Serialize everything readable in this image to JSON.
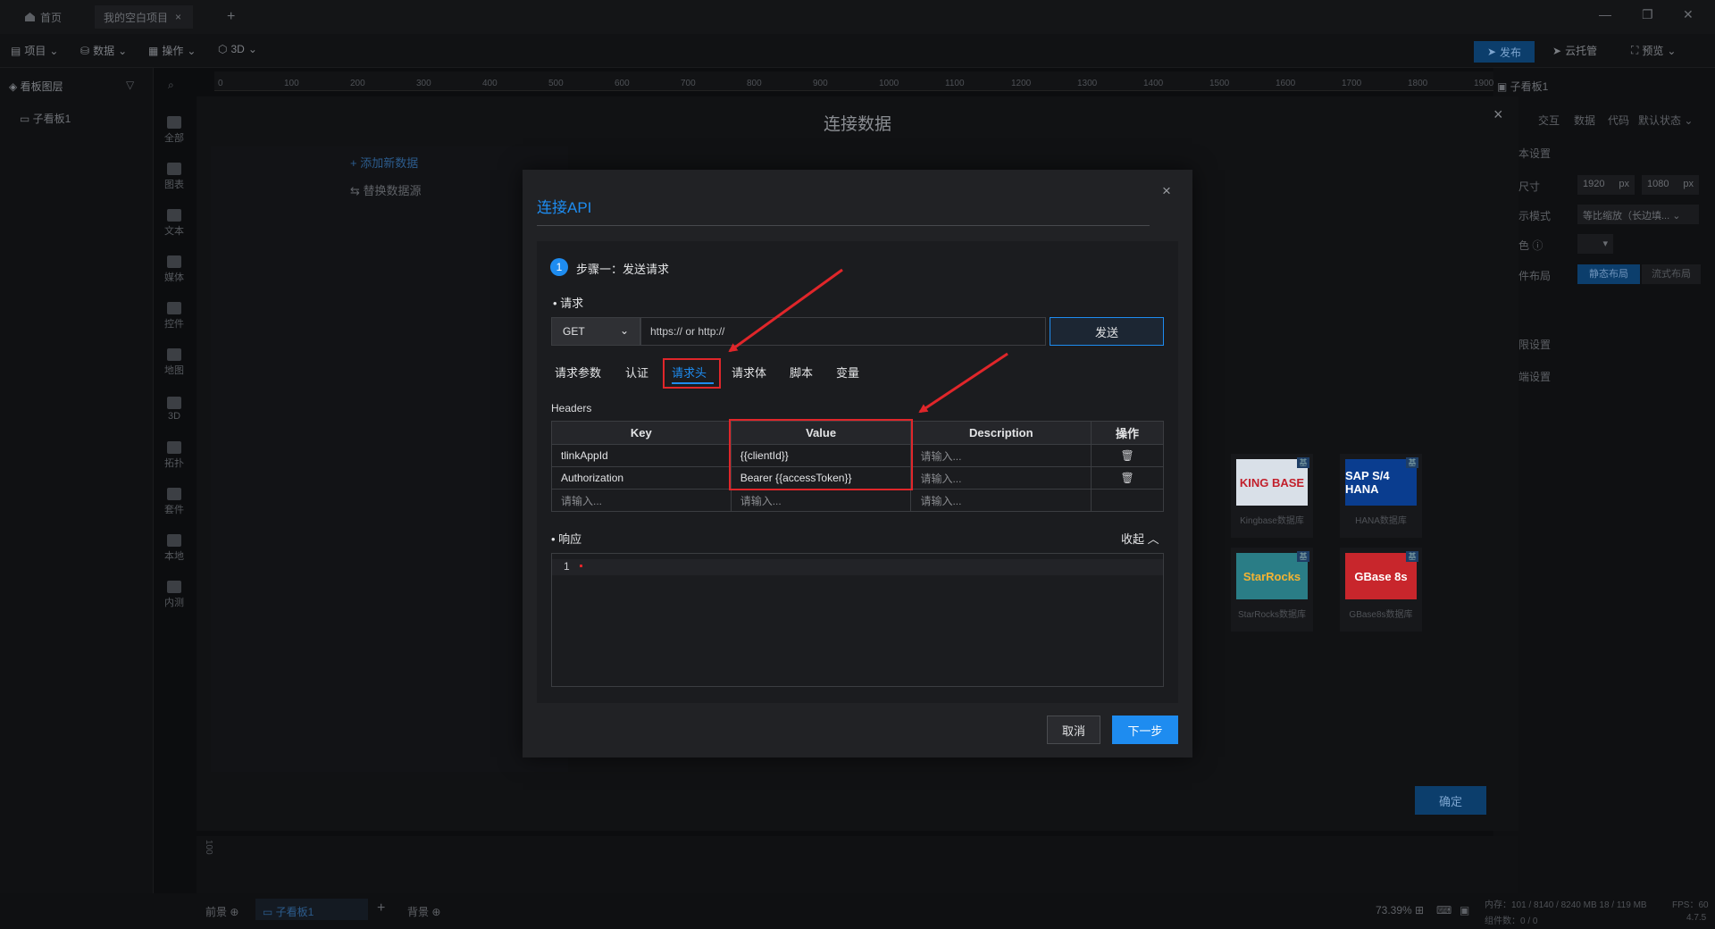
{
  "titlebar": {
    "home_tab": "首页",
    "project_tab": "我的空白项目",
    "close_glyph": "×",
    "add_glyph": "+"
  },
  "menu": {
    "project": "项目",
    "data": "数据",
    "operate": "操作",
    "three_d": "3D",
    "publish": "发布",
    "cloud": "云托管",
    "preview": "预览"
  },
  "left": {
    "layer_title": "看板图层",
    "layer_item": "子看板1",
    "icons": [
      "全部",
      "图表",
      "文本",
      "媒体",
      "控件",
      "地图",
      "3D",
      "拓扑",
      "套件",
      "本地",
      "内测"
    ]
  },
  "ruler": {
    "ticks": [
      "0",
      "100",
      "200",
      "300",
      "400",
      "500",
      "600",
      "700",
      "800",
      "900",
      "1000",
      "1100",
      "1200",
      "1300",
      "1400",
      "1500",
      "1600",
      "1700",
      "1800",
      "1900"
    ]
  },
  "right": {
    "title": "子看板1",
    "tabs": [
      "交互",
      "数据",
      "代码",
      "默认状态"
    ],
    "basic": "本设置",
    "size_label": "尺寸",
    "width": "1920",
    "height": "1080",
    "unit": "px",
    "display_label": "示模式",
    "display_value": "等比缩放（长边填...",
    "color_label": "色",
    "layout_label": "件布局",
    "layout_static": "静态布局",
    "layout_flow": "流式布局",
    "row_a": "限设置",
    "row_b": "端设置"
  },
  "bgmodal": {
    "title": "连接数据",
    "add_new": "添加新数据",
    "replace_source": "替换数据源",
    "confirm": "确定",
    "cards": [
      {
        "logo": "KING BASE",
        "caption": "Kingbase数据库",
        "bg": "#d9e0e8",
        "fg": "#c21f2b"
      },
      {
        "logo": "SAP S/4 HANA",
        "caption": "HANA数据库",
        "bg": "#0a3d8f",
        "fg": "#ffffff"
      },
      {
        "logo": "StarRocks",
        "caption": "StarRocks数据库",
        "bg": "#2a7d86",
        "fg": "#f3b333"
      },
      {
        "logo": "GBase 8s",
        "caption": "GBase8s数据库",
        "bg": "#c8262c",
        "fg": "#ffffff"
      }
    ],
    "badge": "基"
  },
  "dialog": {
    "title": "连接API",
    "close_glyph": "×",
    "step_number": "1",
    "step_text": "步骤一：发送请求",
    "request_label": "请求",
    "method": "GET",
    "url_placeholder": "https:// or http://",
    "send": "发送",
    "tabs": [
      "请求参数",
      "认证",
      "请求头",
      "请求体",
      "脚本",
      "变量"
    ],
    "active_tab": "请求头",
    "headers_label": "Headers",
    "columns": [
      "Key",
      "Value",
      "Description",
      "操作"
    ],
    "rows": [
      {
        "key": "tlinkAppId",
        "value": "{{clientId}}",
        "description": "请输入..."
      },
      {
        "key": "Authorization",
        "value": "Bearer {{accessToken}}",
        "description": "请输入..."
      },
      {
        "key": "请输入...",
        "value": "请输入...",
        "description": "请输入..."
      }
    ],
    "response_label": "响应",
    "collapse": "收起",
    "line_number": "1",
    "cancel": "取消",
    "next": "下一步"
  },
  "bottom": {
    "front": "前景",
    "sub_board": "子看板1",
    "back": "背景",
    "zoom": "73.39%",
    "memory": "内存：101 / 8140 / 8240 MB 18 / 119 MB",
    "fps": "FPS：60",
    "components": "组件数：0 / 0",
    "version": "4.7.5"
  },
  "colors": {
    "accent": "#1e8cf0",
    "highlight_red": "#e0262a",
    "dialog_bg": "#212225"
  }
}
